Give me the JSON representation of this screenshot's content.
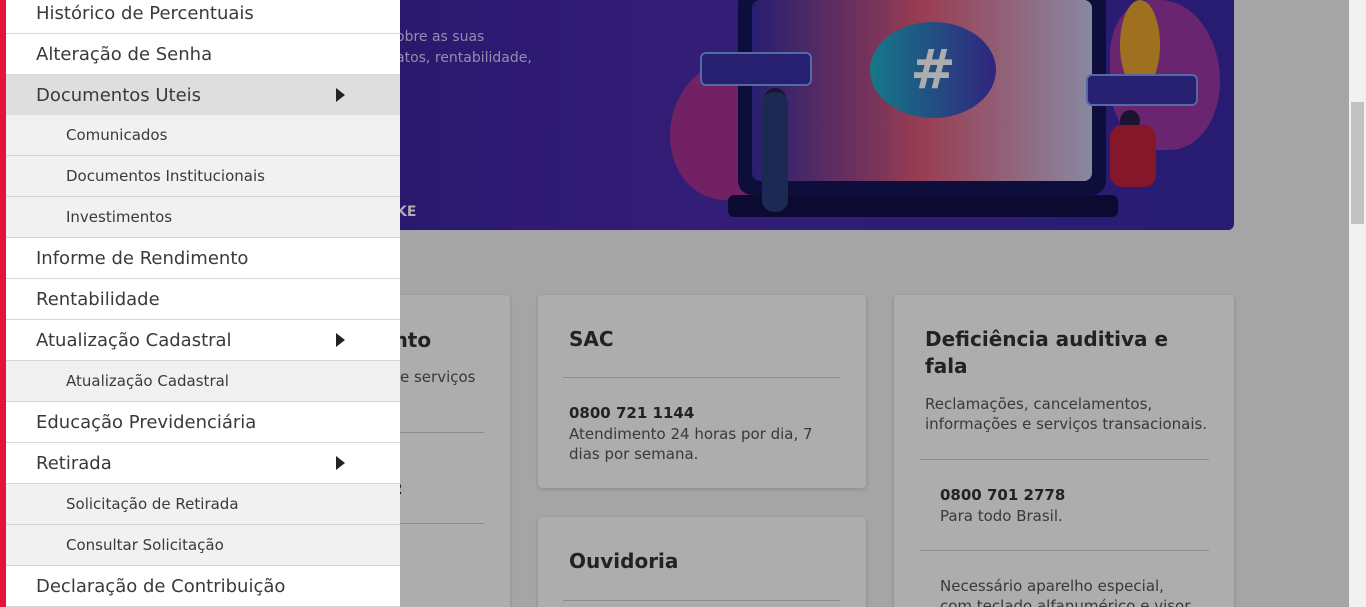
{
  "hero": {
    "text": "obre as suas\natos, rentabilidade,",
    "brand": "KE",
    "bubble_symbol": "#"
  },
  "cards": {
    "first": {
      "title": "ento",
      "text": "e serviços",
      "phone": "2"
    },
    "sac": {
      "title": "SAC",
      "phone": "0800 721 1144",
      "text": "Atendimento 24 horas por dia, 7 dias por semana."
    },
    "ouvidoria": {
      "title": "Ouvidoria"
    },
    "deficiencia": {
      "title": "Deficiência auditiva e fala",
      "text": "Reclamações, cancelamentos, informações e serviços transacionais.",
      "phone": "0800 701 2778",
      "phone_text": "Para todo Brasil.",
      "note": "Necessário aparelho especial, com teclado alfanumérico e visor."
    }
  },
  "menu": {
    "items": [
      {
        "label": "Histórico de Percentuais"
      },
      {
        "label": "Alteração de Senha"
      },
      {
        "label": "Documentos Uteis"
      },
      {
        "label": "Comunicados"
      },
      {
        "label": "Documentos Institucionais"
      },
      {
        "label": "Investimentos"
      },
      {
        "label": "Informe de Rendimento"
      },
      {
        "label": "Rentabilidade"
      },
      {
        "label": "Atualização Cadastral"
      },
      {
        "label": "Atualização Cadastral"
      },
      {
        "label": "Educação Previdenciária"
      },
      {
        "label": "Retirada"
      },
      {
        "label": "Solicitação de Retirada"
      },
      {
        "label": "Consultar Solicitação"
      },
      {
        "label": "Declaração de Contribuição"
      }
    ]
  },
  "colors": {
    "accent": "#e3143a",
    "hero_bg": "#3c22a0",
    "active_item": "#dedede"
  }
}
